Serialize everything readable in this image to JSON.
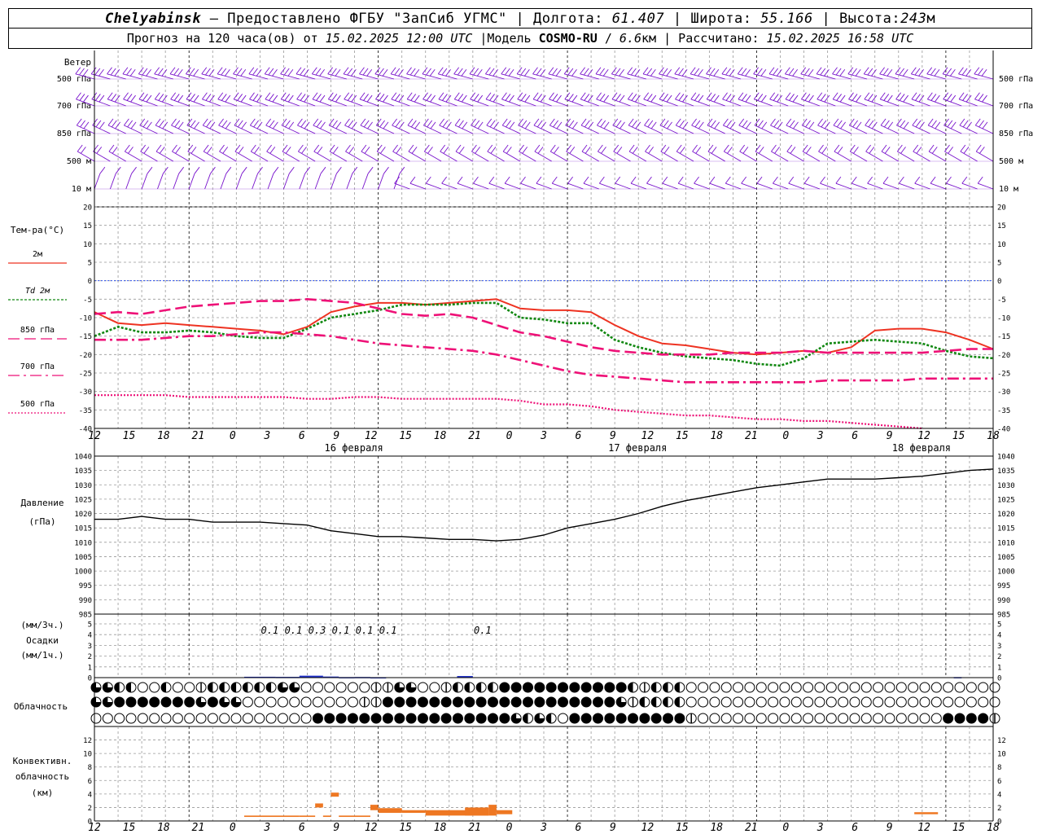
{
  "header": {
    "city": "Chelyabinsk",
    "dash": "–",
    "provider": "Предоставлено ФГБУ \"ЗапСиб УГМС\"",
    "sep": "|",
    "lon_label": "Долгота:",
    "lon_value": "61.407",
    "lat_label": "Широта:",
    "lat_value": "55.166",
    "alt_label": "Высота:",
    "alt_value": "243",
    "alt_unit": "м",
    "forecast_prefix": "Прогноз на 120 часа(ов) от",
    "forecast_time": "15.02.2025 12:00 UTC",
    "model_label": "Модель",
    "model_name": "COSMO-RU",
    "model_slash": "/",
    "model_res": "6.6",
    "model_res_unit": "км",
    "calc_label": "Рассчитано:",
    "calc_time": "15.02.2025 16:58 UTC"
  },
  "colors": {
    "t2m": "#ee3322",
    "td2m": "#118811",
    "t850": "#ee1177",
    "t700": "#ee1177",
    "t500": "#ee1177",
    "wind": "#7711cc",
    "pressure": "#000000",
    "precip": "#2233cc",
    "convective": "#ee7722",
    "zero_line": "#3355ee",
    "grid": "#999999"
  },
  "chart_data": [
    {
      "type": "wind-barbs",
      "title": "Ветер",
      "levels": [
        "500 гПа",
        "700 гПа",
        "850 гПа",
        "500 м",
        "10 м"
      ],
      "x_start_hour": 12,
      "x_step_hours": 1,
      "note_steps": 31,
      "direction_trend": "westerly, speeds highest aloft"
    },
    {
      "type": "line",
      "title": "Тем-ра(°С)",
      "ylim": [
        -40,
        20
      ],
      "yticks": [
        20,
        15,
        10,
        5,
        0,
        -5,
        -10,
        -15,
        -20,
        -25,
        -30,
        -35,
        -40
      ],
      "x_hours_from_start": [
        0,
        3,
        6,
        9,
        12,
        15,
        18,
        21,
        24,
        27,
        30,
        33,
        36,
        39,
        42,
        45,
        48,
        51,
        54,
        57,
        60,
        63,
        66,
        69,
        72,
        75,
        78,
        81,
        84,
        87,
        90,
        93,
        96,
        99,
        102,
        105,
        108,
        111,
        114
      ],
      "series": [
        {
          "name": "2м",
          "style": "solid",
          "values": [
            -8.5,
            -11.5,
            -12,
            -11.5,
            -12,
            -12.5,
            -13,
            -13.5,
            -14.5,
            -12.5,
            -8.5,
            -7,
            -6,
            -6,
            -6.5,
            -6,
            -5.5,
            -5,
            -7.5,
            -8,
            -8,
            -8.5,
            -12,
            -15,
            -17,
            -17.5,
            -18.5,
            -19.5,
            -20,
            -19.5,
            -19,
            -19.5,
            -18,
            -13.5,
            -13,
            -13,
            -14,
            -16,
            -18.5
          ]
        },
        {
          "name": "Td 2м",
          "style": "dotted",
          "values": [
            -15,
            -12.5,
            -14,
            -14,
            -13.5,
            -14,
            -15,
            -15.5,
            -15.5,
            -13,
            -10,
            -9,
            -8,
            -6.5,
            -6.5,
            -6.5,
            -6,
            -6,
            -10,
            -10.5,
            -11.5,
            -11.5,
            -16,
            -18,
            -19.5,
            -20.5,
            -21,
            -21.5,
            -22.5,
            -23,
            -21,
            -17,
            -16.5,
            -16,
            -16.5,
            -17,
            -19,
            -20.5,
            -21
          ]
        },
        {
          "name": "850 гПа",
          "style": "dashed",
          "values": [
            -9,
            -8.5,
            -9,
            -8,
            -7,
            -6.5,
            -6,
            -5.5,
            -5.5,
            -5,
            -5.5,
            -6,
            -7.5,
            -9,
            -9.5,
            -9,
            -10,
            -12,
            -14,
            -15,
            -16.5,
            -18,
            -19,
            -19.5,
            -20,
            -20,
            -20,
            -19.5,
            -19.5,
            -19.5,
            -19,
            -19.5,
            -19.5,
            -19.5,
            -19.5,
            -19.5,
            -19,
            -18.5,
            -18.5
          ]
        },
        {
          "name": "700 гПа",
          "style": "dash-dot",
          "values": [
            -16,
            -16,
            -16,
            -15.5,
            -15,
            -15,
            -14.5,
            -14,
            -14,
            -14.5,
            -15,
            -16,
            -17,
            -17.5,
            -18,
            -18.5,
            -19,
            -20,
            -21.5,
            -23,
            -24.5,
            -25.5,
            -26,
            -26.5,
            -27,
            -27.5,
            -27.5,
            -27.5,
            -27.5,
            -27.5,
            -27.5,
            -27,
            -27,
            -27,
            -27,
            -26.5,
            -26.5,
            -26.5,
            -26.5
          ]
        },
        {
          "name": "500 гПа",
          "style": "dense-dotted",
          "values": [
            -31,
            -31,
            -31,
            -31,
            -31.5,
            -31.5,
            -31.5,
            -31.5,
            -31.5,
            -32,
            -32,
            -31.5,
            -31.5,
            -32,
            -32,
            -32,
            -32,
            -32,
            -32.5,
            -33.5,
            -33.5,
            -34,
            -35,
            -35.5,
            -36,
            -36.5,
            -36.5,
            -37,
            -37.5,
            -37.5,
            -38,
            -38,
            -38.5,
            -39,
            -39.5,
            -40
          ]
        }
      ],
      "x_tick_labels": [
        "12",
        "15",
        "18",
        "21",
        "0",
        "3",
        "6",
        "9",
        "12",
        "15",
        "18",
        "21",
        "0",
        "3",
        "6",
        "9",
        "12",
        "15",
        "18",
        "21",
        "0",
        "3",
        "6",
        "9",
        "12",
        "15",
        "18"
      ],
      "date_labels": [
        "16 февраля",
        "17 февраля",
        "18 февраля"
      ]
    },
    {
      "type": "line",
      "title": "Давление",
      "ylabel": "(гПа)",
      "ylim": [
        985,
        1040
      ],
      "yticks": [
        1040,
        1035,
        1030,
        1025,
        1020,
        1015,
        1010,
        1005,
        1000,
        995,
        990,
        985
      ],
      "x_hours_from_start": [
        0,
        3,
        6,
        9,
        12,
        15,
        18,
        21,
        24,
        27,
        30,
        33,
        36,
        39,
        42,
        45,
        48,
        51,
        54,
        57,
        60,
        63,
        66,
        69,
        72,
        75,
        78,
        81,
        84,
        87,
        90,
        93,
        96,
        99,
        102,
        105,
        108,
        111,
        114
      ],
      "series": [
        {
          "name": "",
          "values": [
            1018,
            1018,
            1019,
            1018,
            1018,
            1017,
            1017,
            1017,
            1016.5,
            1016,
            1014,
            1013,
            1012,
            1012,
            1011.5,
            1011,
            1011,
            1010.5,
            1011,
            1012.5,
            1015,
            1016.5,
            1018,
            1020,
            1022.5,
            1024.5,
            1026,
            1027.5,
            1029,
            1030,
            1031,
            1032,
            1032,
            1032,
            1032.5,
            1033,
            1034,
            1035,
            1035.5
          ]
        }
      ]
    },
    {
      "type": "bar",
      "title": "Осадки",
      "ylabel_top": "(мм/3ч.)",
      "ylabel_bottom": "(мм/1ч.)",
      "ylim": [
        0,
        5
      ],
      "yticks": [
        5,
        4,
        3,
        2,
        1,
        0
      ],
      "labels": [
        {
          "hour": 21,
          "text": "0.1"
        },
        {
          "hour": 24,
          "text": "0.1"
        },
        {
          "hour": 27,
          "text": "0.3"
        },
        {
          "hour": 30,
          "text": "0.1"
        },
        {
          "hour": 33,
          "text": "0.1"
        },
        {
          "hour": 36,
          "text": "0.1"
        },
        {
          "hour": 48,
          "text": "0.1"
        }
      ],
      "hourly": [
        {
          "h0": 19,
          "h1": 23,
          "value": 0.08
        },
        {
          "h0": 23,
          "h1": 26,
          "value": 0.07
        },
        {
          "h0": 26,
          "h1": 29,
          "value": 0.18
        },
        {
          "h0": 29,
          "h1": 31,
          "value": 0.1
        },
        {
          "h0": 31,
          "h1": 33,
          "value": 0.05
        },
        {
          "h0": 33,
          "h1": 35,
          "value": 0.06
        },
        {
          "h0": 35,
          "h1": 37,
          "value": 0.04
        },
        {
          "h0": 46,
          "h1": 48,
          "value": 0.15
        },
        {
          "h0": 109,
          "h1": 110,
          "value": 0.05
        }
      ]
    },
    {
      "type": "table",
      "title": "Облачность",
      "symbols_per_row": 78,
      "rows": [
        "RRLLOOLOOHLLLLLLRROOOOOOHHRROOHLLLLFFFFFFFFFFFLHLLLOOOOOOOOOOOOOOOOOOOOOOOOOOOOO",
        "RRFFFFFFFRFRROOOOOOOOOOHHFFFFFFFFFFFFFFFFFFFFRHLLLLOOOOOOOOOOOOOOOOOOOOOOOOOOOOOOO",
        "OOOOOOOOOOOOOOOOOOOFFFFFFFFFFFFFFFFFRLRLOFFFFFFFFFFHOOOOOOOOOOOOOOOOOOOOOFFFFHOH"
      ],
      "legend": {
        "F": "full",
        "O": "clear",
        "L": "half",
        "R": "three-quarters",
        "H": "vertical-half"
      }
    },
    {
      "type": "bar",
      "title": "Конвективн. облачность",
      "ylabel": "(км)",
      "ylim": [
        0,
        14
      ],
      "yticks": [
        12,
        10,
        8,
        6,
        4,
        2,
        0
      ],
      "segments": [
        {
          "h0": 19,
          "h1": 26,
          "bottom": 0.6,
          "top": 0.8
        },
        {
          "h0": 26,
          "h1": 28,
          "bottom": 0.6,
          "top": 0.8
        },
        {
          "h0": 28,
          "h1": 29,
          "bottom": 2,
          "top": 2.6
        },
        {
          "h0": 29,
          "h1": 30,
          "bottom": 0.6,
          "top": 0.8
        },
        {
          "h0": 30,
          "h1": 31,
          "bottom": 3.6,
          "top": 4.2
        },
        {
          "h0": 31,
          "h1": 35,
          "bottom": 0.6,
          "top": 0.8
        },
        {
          "h0": 35,
          "h1": 36,
          "bottom": 1.6,
          "top": 2.4
        },
        {
          "h0": 36,
          "h1": 39,
          "bottom": 1.2,
          "top": 1.9
        },
        {
          "h0": 39,
          "h1": 42,
          "bottom": 1.2,
          "top": 1.6
        },
        {
          "h0": 42,
          "h1": 50,
          "bottom": 0.8,
          "top": 1.6
        },
        {
          "h0": 47,
          "h1": 50,
          "bottom": 0.8,
          "top": 2
        },
        {
          "h0": 50,
          "h1": 51,
          "bottom": 0.8,
          "top": 2.4
        },
        {
          "h0": 51,
          "h1": 53,
          "bottom": 1,
          "top": 1.6
        },
        {
          "h0": 104,
          "h1": 107,
          "bottom": 1,
          "top": 1.3
        }
      ]
    }
  ]
}
